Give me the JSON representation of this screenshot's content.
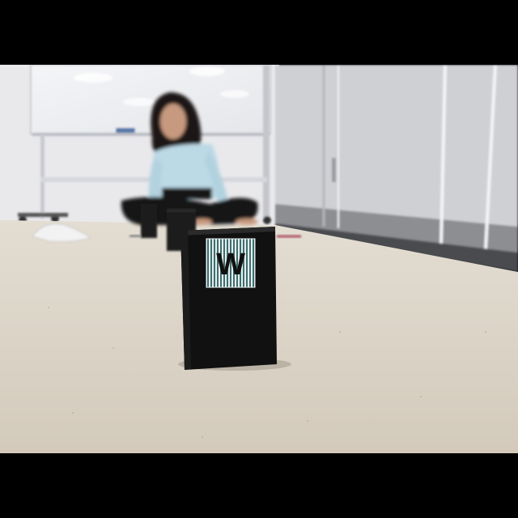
{
  "scene": {
    "description_tags": [
      "person-seated-on-floor",
      "whiteboard",
      "lockers",
      "black-boxes",
      "speckled-floor"
    ],
    "front_box": {
      "label": "W"
    }
  },
  "colors": {
    "letterbox_black": "#000000",
    "floor": "#d8d1c4",
    "wall_left": "#e9e9ec",
    "locker_panel": "#cfcfd3",
    "locker_base": "#8d8e92",
    "box_black": "#111111",
    "shirt": "#bcd9e6",
    "pants": "#151515",
    "hair": "#1b1512",
    "stripe_teal": "#3d6e70"
  }
}
